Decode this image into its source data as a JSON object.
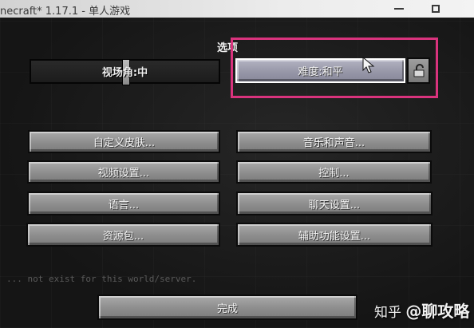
{
  "window": {
    "title": "necraft* 1.17.1 - 单人游戏"
  },
  "screen": {
    "title": "选项"
  },
  "fov_slider": {
    "label": "视场角:中",
    "value_fraction": 0.5
  },
  "difficulty_button": {
    "label": "难度:和平"
  },
  "buttons": {
    "skin": "自定义皮肤...",
    "music": "音乐和声音...",
    "video": "视频设置...",
    "controls": "控制...",
    "language": "语言...",
    "chat": "聊天设置...",
    "resource_packs": "资源包...",
    "accessibility": "辅助功能设置...",
    "done": "完成"
  },
  "chat_text": "... not exist for this world/server.",
  "watermark": {
    "site": "知乎",
    "author": "@聊攻略"
  },
  "colors": {
    "highlight_box": "#d9337d",
    "button_face": "#8d8d8d",
    "button_border": "#0b0b0b"
  }
}
